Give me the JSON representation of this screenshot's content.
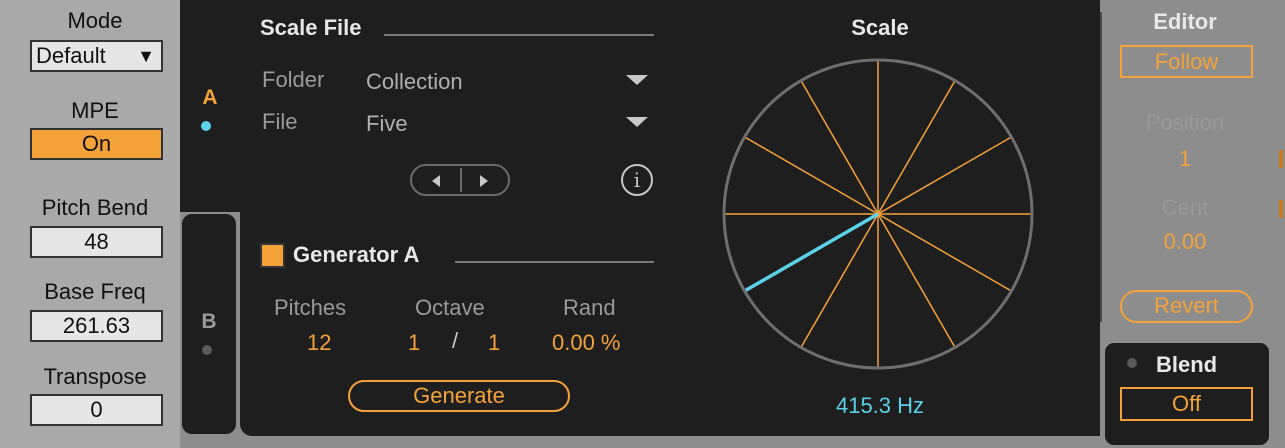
{
  "global": {
    "mode_label": "Mode",
    "mode_value": "Default",
    "mpe_label": "MPE",
    "mpe_value": "On",
    "pitch_bend_label": "Pitch Bend",
    "pitch_bend_value": "48",
    "base_freq_label": "Base Freq",
    "base_freq_value": "261.63",
    "transpose_label": "Transpose",
    "transpose_value": "0"
  },
  "tabs": [
    {
      "label": "A",
      "active": true,
      "dot_color": "#5cd2e8"
    },
    {
      "label": "B",
      "active": false,
      "dot_color": "#5a5a5a"
    }
  ],
  "scale_file": {
    "title": "Scale File",
    "folder_label": "Folder",
    "folder_value": "Collection",
    "file_label": "File",
    "file_value": "Five",
    "info_glyph": "i",
    "icons": [
      "prev-arrow-icon",
      "next-arrow-icon",
      "info-icon",
      "dropdown-arrow-icon"
    ]
  },
  "generator": {
    "title": "Generator A",
    "enabled": true,
    "pitches_label": "Pitches",
    "pitches_value": "12",
    "octave_label": "Octave",
    "octave_num": "1",
    "octave_sep": "/",
    "octave_den": "1",
    "rand_label": "Rand",
    "rand_value": "0.00 %",
    "generate_label": "Generate"
  },
  "scale": {
    "title": "Scale",
    "divisions": 12,
    "highlight_index": 8,
    "frequency": "415.3 Hz"
  },
  "editor": {
    "title": "Editor",
    "follow_label": "Follow",
    "position_label": "Position",
    "position_value": "1",
    "cent_label": "Cent",
    "cent_value": "0.00",
    "revert_label": "Revert"
  },
  "blend": {
    "label": "Blend",
    "value": "Off"
  },
  "colors": {
    "accent": "#f4a23a",
    "highlight": "#5cd2e8",
    "panel_dark": "#1e1e1e",
    "panel_light": "#a9a9a9"
  }
}
